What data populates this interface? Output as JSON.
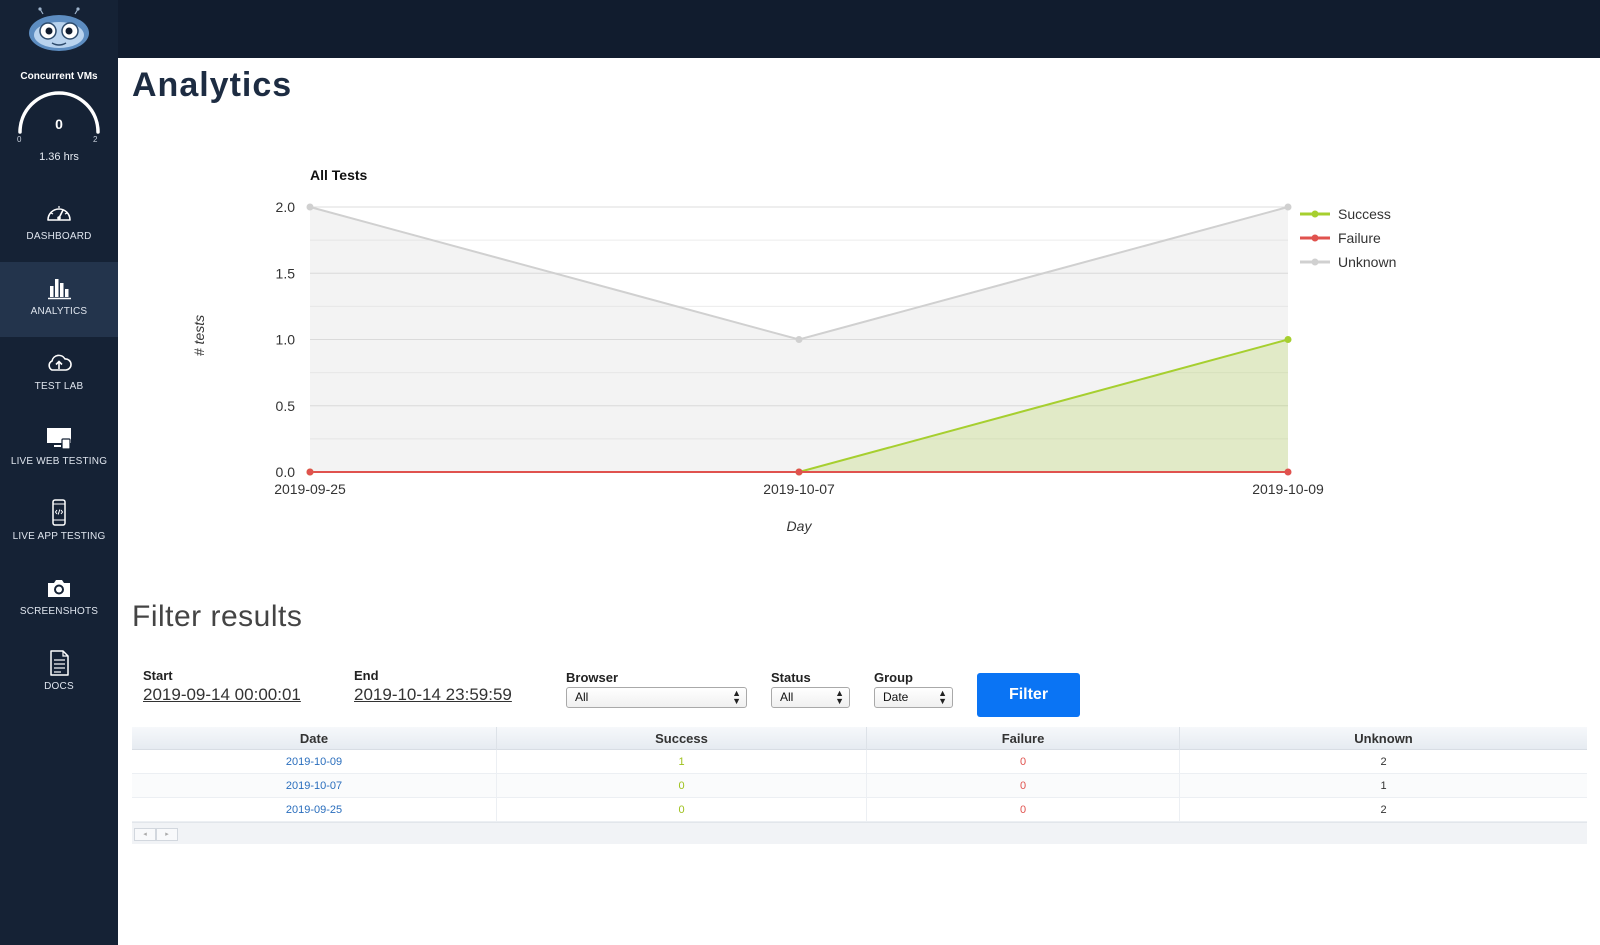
{
  "sidebar": {
    "vm_title": "Concurrent VMs",
    "gauge": {
      "value": "0",
      "min": "0",
      "max": "2",
      "hours": "1.36 hrs"
    },
    "items": [
      {
        "label": "DASHBOARD",
        "icon": "speedometer-icon"
      },
      {
        "label": "ANALYTICS",
        "icon": "bar-chart-icon",
        "active": true
      },
      {
        "label": "TEST LAB",
        "icon": "cloud-upload-icon"
      },
      {
        "label": "LIVE WEB TESTING",
        "icon": "monitor-icon"
      },
      {
        "label": "LIVE APP TESTING",
        "icon": "phone-code-icon"
      },
      {
        "label": "SCREENSHOTS",
        "icon": "camera-icon"
      },
      {
        "label": "DOCS",
        "icon": "document-icon"
      }
    ]
  },
  "page": {
    "title": "Analytics"
  },
  "chart_data": {
    "type": "area",
    "title": "All Tests",
    "xlabel": "Day",
    "ylabel": "# tests",
    "categories": [
      "2019-09-25",
      "2019-10-07",
      "2019-10-09"
    ],
    "yticks": [
      "0.0",
      "0.5",
      "1.0",
      "1.5",
      "2.0"
    ],
    "ylim": [
      0,
      2
    ],
    "grid": true,
    "legend_position": "top-right",
    "series": [
      {
        "name": "Success",
        "values": [
          0,
          0,
          1
        ],
        "color": "#a6cf2f"
      },
      {
        "name": "Failure",
        "values": [
          0,
          0,
          0
        ],
        "color": "#e0524e"
      },
      {
        "name": "Unknown",
        "values": [
          2,
          1,
          2
        ],
        "color": "#d0d0d0"
      }
    ]
  },
  "filter": {
    "title": "Filter results",
    "start_label": "Start",
    "start_value": "2019-09-14 00:00:01",
    "end_label": "End",
    "end_value": "2019-10-14 23:59:59",
    "browser_label": "Browser",
    "browser_value": "All",
    "status_label": "Status",
    "status_value": "All",
    "group_label": "Group",
    "group_value": "Date",
    "button_label": "Filter"
  },
  "table": {
    "headers": [
      "Date",
      "Success",
      "Failure",
      "Unknown"
    ],
    "rows": [
      [
        "2019-10-09",
        "1",
        "0",
        "2"
      ],
      [
        "2019-10-07",
        "0",
        "0",
        "1"
      ],
      [
        "2019-09-25",
        "0",
        "0",
        "2"
      ]
    ],
    "pager_prev": "◂",
    "pager_next": "▸"
  }
}
